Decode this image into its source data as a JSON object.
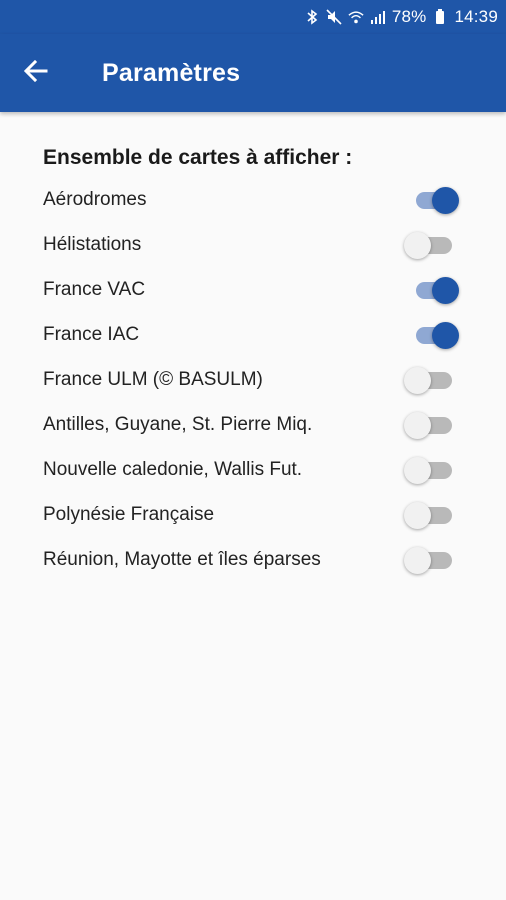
{
  "status_bar": {
    "battery": "78%",
    "time": "14:39",
    "icons": [
      "bluetooth-icon",
      "mute-icon",
      "wifi-icon",
      "signal-icon",
      "battery-icon"
    ]
  },
  "app_bar": {
    "title": "Paramètres",
    "back_icon": "arrow-back-icon",
    "color": "#1f56a8"
  },
  "settings": {
    "section_title": "Ensemble de cartes à afficher :",
    "items": [
      {
        "label": "Aérodromes",
        "enabled": true
      },
      {
        "label": "Hélistations",
        "enabled": false
      },
      {
        "label": "France VAC",
        "enabled": true
      },
      {
        "label": "France IAC",
        "enabled": true
      },
      {
        "label": "France ULM (© BASULM)",
        "enabled": false
      },
      {
        "label": "Antilles, Guyane, St. Pierre Miq.",
        "enabled": false
      },
      {
        "label": "Nouvelle caledonie, Wallis Fut.",
        "enabled": false
      },
      {
        "label": "Polynésie Française",
        "enabled": false
      },
      {
        "label": "Réunion, Mayotte et îles éparses",
        "enabled": false
      }
    ]
  }
}
